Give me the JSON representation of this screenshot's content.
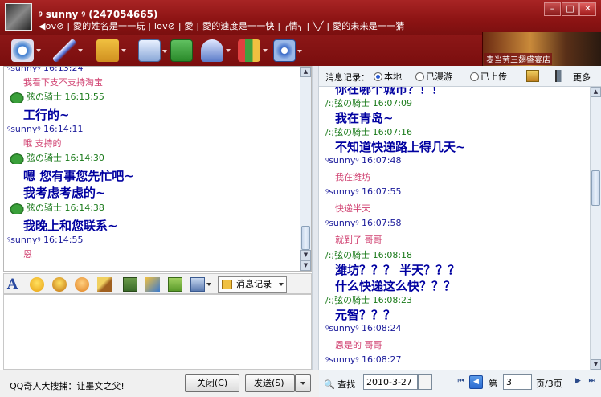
{
  "window": {
    "nickname": "ꝰ sunny ꝰ (247054665)",
    "signature": "◀ov⊘ | 愛的姓名是一一玩 | ⅼov⊘ | 愛 | 愛的速度是一一快 | ╭情╮ | ╲╱ | 愛的未来是一一猜",
    "controls": [
      "–",
      "□",
      "✕"
    ]
  },
  "banner": {
    "text": "麦当劳三翅盛宴店"
  },
  "toolbar": {
    "icons": [
      "video-call-icon",
      "voice-call-icon",
      "send-file-icon",
      "send-email-icon",
      "create-group-icon",
      "apps-icon",
      "games-icon",
      "settings-icon"
    ]
  },
  "left_chat": {
    "messages": [
      {
        "kind": "other-header",
        "text": "ꝰsunnyꝰ  16:13:24"
      },
      {
        "kind": "pink",
        "text": "我看下支不支持淘宝"
      },
      {
        "kind": "me-header",
        "text": "弦の骑士   16:13:55"
      },
      {
        "kind": "blue",
        "text": "工行的~"
      },
      {
        "kind": "other-header",
        "text": "ꝰsunnyꝰ  16:14:11"
      },
      {
        "kind": "pink",
        "text": "哦 支持的"
      },
      {
        "kind": "me-header",
        "text": "弦の骑士   16:14:30"
      },
      {
        "kind": "blue",
        "text": "嗯 您有事您先忙吧~"
      },
      {
        "kind": "blue",
        "text": "我考虑考虑的~"
      },
      {
        "kind": "me-header",
        "text": "弦の骑士   16:14:38"
      },
      {
        "kind": "blue",
        "text": "我晚上和您联系~"
      },
      {
        "kind": "other-header",
        "text": "ꝰsunnyꝰ  16:14:55"
      },
      {
        "kind": "pink",
        "text": "恩"
      }
    ]
  },
  "input_toolbar": {
    "message_record_label": "消息记录"
  },
  "bottom": {
    "search_promo": "QQ奇人大搜捕：让墨文之父!",
    "close_label": "关闭(C)",
    "send_label": "发送(S)"
  },
  "history": {
    "label": "消息记录：",
    "radio_local": "本地",
    "radio_roaming": "已漫游",
    "radio_uploaded": "已上传",
    "more": "更多",
    "messages": [
      {
        "kind": "blue",
        "text": "你在哪个城市？！！"
      },
      {
        "kind": "me-header",
        "text": "/:;弦の骑士   16:07:09"
      },
      {
        "kind": "blue",
        "text": "我在青岛~"
      },
      {
        "kind": "me-header",
        "text": "/:;弦の骑士   16:07:16"
      },
      {
        "kind": "blue",
        "text": "不知道快递路上得几天~"
      },
      {
        "kind": "other-header",
        "text": "ꝰsunnyꝰ  16:07:48"
      },
      {
        "kind": "pink",
        "text": "我在潍坊"
      },
      {
        "kind": "other-header",
        "text": "ꝰsunnyꝰ  16:07:55"
      },
      {
        "kind": "pink",
        "text": "快递半天"
      },
      {
        "kind": "other-header",
        "text": "ꝰsunnyꝰ  16:07:58"
      },
      {
        "kind": "pink",
        "text": "就到了 哥哥"
      },
      {
        "kind": "me-header",
        "text": "/:;弦の骑士   16:08:18"
      },
      {
        "kind": "blue",
        "text": "潍坊？？？ 半天？？？"
      },
      {
        "kind": "blue",
        "text": "什么快递这么快？？？"
      },
      {
        "kind": "me-header",
        "text": "/:;弦の骑士   16:08:23"
      },
      {
        "kind": "blue",
        "text": "元智？？？"
      },
      {
        "kind": "other-header",
        "text": "ꝰsunnyꝰ  16:08:24"
      },
      {
        "kind": "pink",
        "text": "恩是的 哥哥"
      },
      {
        "kind": "other-header",
        "text": "ꝰsunnyꝰ  16:08:27"
      }
    ],
    "footer": {
      "search_label": "查找",
      "date": "2010-3-27",
      "page_prefix": "第",
      "page_value": "3",
      "page_suffix": "页/3页"
    }
  }
}
